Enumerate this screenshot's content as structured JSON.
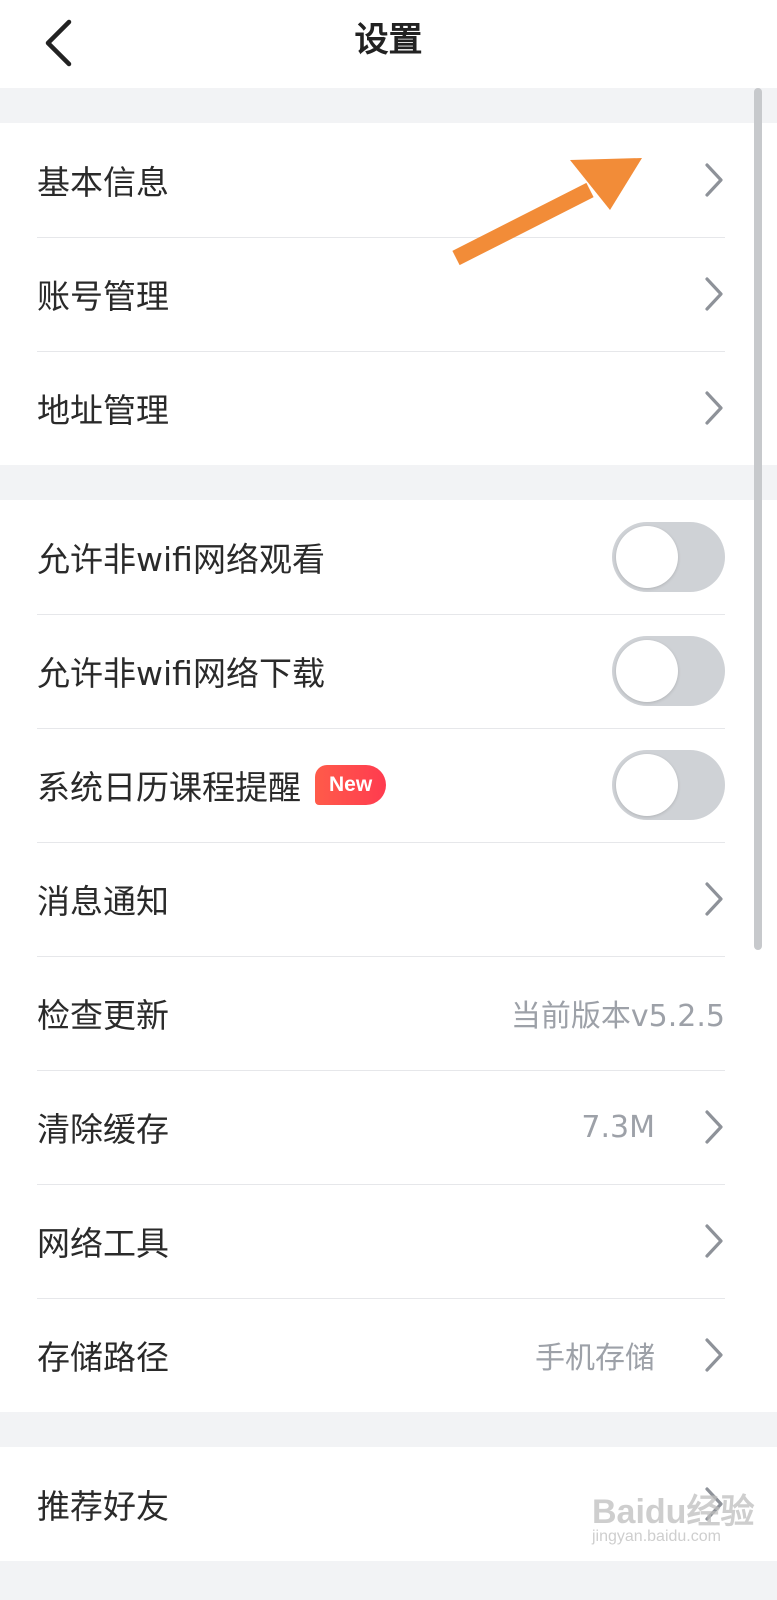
{
  "header": {
    "title": "设置",
    "back_icon": "chevron-left-icon"
  },
  "sections": [
    {
      "rows": [
        {
          "label": "基本信息",
          "type": "link"
        },
        {
          "label": "账号管理",
          "type": "link"
        },
        {
          "label": "地址管理",
          "type": "link"
        }
      ]
    },
    {
      "rows": [
        {
          "label": "允许非wifi网络观看",
          "type": "toggle",
          "on": false
        },
        {
          "label": "允许非wifi网络下载",
          "type": "toggle",
          "on": false
        },
        {
          "label": "系统日历课程提醒",
          "type": "toggle",
          "on": false,
          "badge": "New"
        },
        {
          "label": "消息通知",
          "type": "link"
        },
        {
          "label": "检查更新",
          "type": "value",
          "value": "当前版本v5.2.5"
        },
        {
          "label": "清除缓存",
          "type": "link",
          "value": "7.3M"
        },
        {
          "label": "网络工具",
          "type": "link"
        },
        {
          "label": "存储路径",
          "type": "link",
          "value": "手机存储"
        }
      ]
    },
    {
      "rows": [
        {
          "label": "推荐好友",
          "type": "link"
        }
      ]
    }
  ],
  "colors": {
    "background": "#f2f3f5",
    "text": "#2a2a2a",
    "muted": "#9da1a8",
    "toggle_off": "#cfd2d6",
    "badge": "#ff4a4f",
    "annotation_arrow": "#f28c38"
  },
  "watermark": {
    "brand": "Baidu经验",
    "sub": "jingyan.baidu.com"
  }
}
